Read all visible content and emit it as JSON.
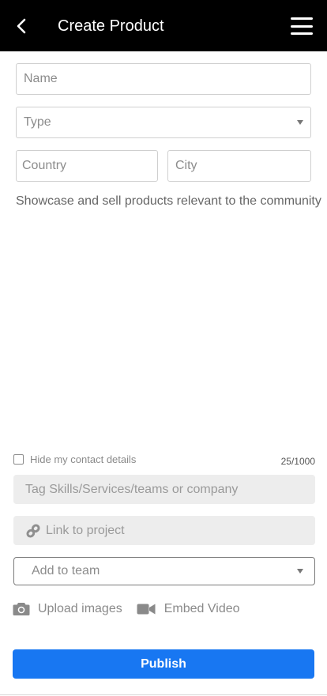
{
  "header": {
    "title": "Create Product"
  },
  "form": {
    "name_placeholder": "Name",
    "type_placeholder": "Type",
    "country_placeholder": "Country",
    "city_placeholder": "City",
    "description": "Showcase and sell products relevant to the community",
    "hide_contact_label": "Hide my contact details",
    "char_counter": "25/1000",
    "tag_placeholder": "Tag Skills/Services/teams or company",
    "link_placeholder": "Link to project",
    "team_placeholder": "Add to team",
    "upload_label": "Upload images",
    "embed_label": "Embed Video",
    "publish_label": "Publish"
  },
  "colors": {
    "header_bg": "#000000",
    "publish_bg": "#1877f2"
  },
  "icons": [
    "back-arrow-icon",
    "hamburger-menu-icon",
    "link-icon",
    "camera-icon",
    "video-camera-icon",
    "chevron-down-icon"
  ]
}
